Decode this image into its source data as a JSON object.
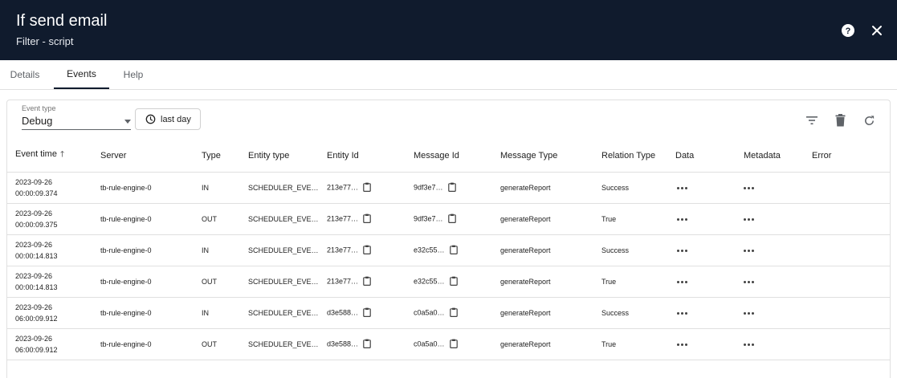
{
  "header": {
    "title": "If send email",
    "subtitle": "Filter - script"
  },
  "tabs": [
    {
      "label": "Details"
    },
    {
      "label": "Events"
    },
    {
      "label": "Help"
    }
  ],
  "filters": {
    "event_type_label": "Event type",
    "event_type_value": "Debug",
    "time_button_label": "last day"
  },
  "table": {
    "columns": [
      "Event time",
      "Server",
      "Type",
      "Entity type",
      "Entity Id",
      "Message Id",
      "Message Type",
      "Relation Type",
      "Data",
      "Metadata",
      "Error"
    ],
    "rows": [
      {
        "date": "2023-09-26",
        "time": "00:00:09.374",
        "server": "tb-rule-engine-0",
        "type": "IN",
        "entity_type": "SCHEDULER_EVE…",
        "entity_id": "213e77…",
        "message_id": "9df3e7…",
        "message_type": "generateReport",
        "relation_type": "Success"
      },
      {
        "date": "2023-09-26",
        "time": "00:00:09.375",
        "server": "tb-rule-engine-0",
        "type": "OUT",
        "entity_type": "SCHEDULER_EVE…",
        "entity_id": "213e77…",
        "message_id": "9df3e7…",
        "message_type": "generateReport",
        "relation_type": "True"
      },
      {
        "date": "2023-09-26",
        "time": "00:00:14.813",
        "server": "tb-rule-engine-0",
        "type": "IN",
        "entity_type": "SCHEDULER_EVE…",
        "entity_id": "213e77…",
        "message_id": "e32c55…",
        "message_type": "generateReport",
        "relation_type": "Success"
      },
      {
        "date": "2023-09-26",
        "time": "00:00:14.813",
        "server": "tb-rule-engine-0",
        "type": "OUT",
        "entity_type": "SCHEDULER_EVE…",
        "entity_id": "213e77…",
        "message_id": "e32c55…",
        "message_type": "generateReport",
        "relation_type": "True"
      },
      {
        "date": "2023-09-26",
        "time": "06:00:09.912",
        "server": "tb-rule-engine-0",
        "type": "IN",
        "entity_type": "SCHEDULER_EVE…",
        "entity_id": "d3e588…",
        "message_id": "c0a5a0…",
        "message_type": "generateReport",
        "relation_type": "Success"
      },
      {
        "date": "2023-09-26",
        "time": "06:00:09.912",
        "server": "tb-rule-engine-0",
        "type": "OUT",
        "entity_type": "SCHEDULER_EVE…",
        "entity_id": "d3e588…",
        "message_id": "c0a5a0…",
        "message_type": "generateReport",
        "relation_type": "True"
      }
    ]
  },
  "icons": {
    "help": "help-circle-icon",
    "close": "close-icon",
    "clock": "clock-icon",
    "filter": "filter-list-icon",
    "delete": "trash-icon",
    "refresh": "refresh-icon",
    "copy": "clipboard-icon",
    "more": "more-horiz-icon"
  }
}
